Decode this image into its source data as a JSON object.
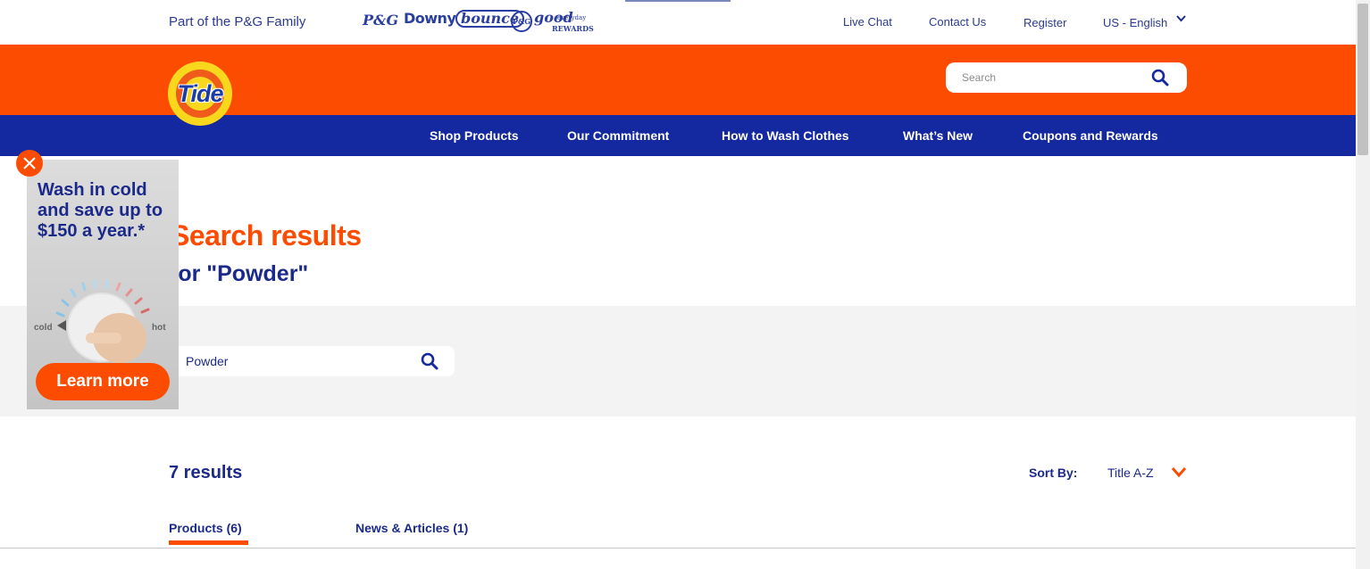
{
  "utility_bar": {
    "family_text": "Part of the P&G Family",
    "brands": {
      "pg": "P&G",
      "downy": "Downy",
      "bounce": "bounce",
      "good_circle": "P&G",
      "good": "good",
      "everyday": "everyday",
      "rewards": "REWARDS"
    },
    "links": {
      "live_chat": "Live Chat",
      "contact_us": "Contact Us",
      "register": "Register",
      "language": "US - English"
    }
  },
  "header": {
    "logo_text": "Tide",
    "search_placeholder": "Search"
  },
  "nav": {
    "items": [
      {
        "label": "Shop Products"
      },
      {
        "label": "Our Commitment"
      },
      {
        "label": "How to Wash Clothes"
      },
      {
        "label": "What’s New"
      },
      {
        "label": "Coupons and Rewards"
      }
    ]
  },
  "results": {
    "title": "Search results",
    "subtitle": "for \"Powder\"",
    "search_value": "Powder",
    "count": "7 results",
    "sort_label": "Sort By:",
    "sort_value": "Title A-Z",
    "tabs": [
      {
        "label": "Products (6)",
        "active": true
      },
      {
        "label": "News & Articles (1)",
        "active": false
      }
    ]
  },
  "ad": {
    "headline": "Wash in cold and save up to $150 a year.*",
    "dial_cold": "cold",
    "dial_hot": "hot",
    "button": "Learn more"
  },
  "colors": {
    "orange": "#fc4c02",
    "blue": "#1428a0",
    "navy_text": "#1b2a8a",
    "gray_band": "#f3f3f3",
    "logo_yellow": "#f9d71c"
  },
  "icons": {
    "search": "search-icon",
    "close": "close-icon",
    "chevron": "chevron-down-icon"
  }
}
